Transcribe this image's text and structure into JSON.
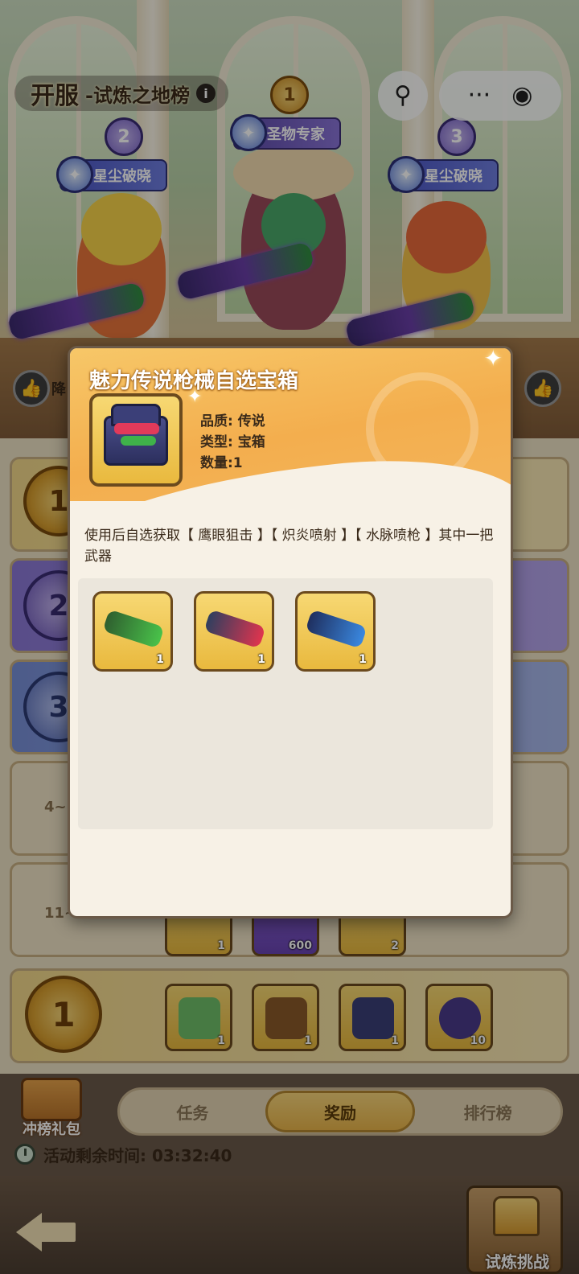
{
  "header": {
    "title_main": "开服",
    "title_sub": "-试炼之地榜",
    "info_glyph": "i"
  },
  "system_buttons": {
    "joystick_glyph": "⚲",
    "more_glyph": "···",
    "target_glyph": "◉"
  },
  "podium": [
    {
      "rank": "1",
      "title": "圣物专家"
    },
    {
      "rank": "2",
      "title": "星尘破晓"
    },
    {
      "rank": "3",
      "title": "星尘破晓"
    }
  ],
  "like_glyph": "👍",
  "partial_text": "降",
  "rows": [
    {
      "label": ""
    },
    {
      "label": ""
    },
    {
      "label": ""
    },
    {
      "label": "4~"
    },
    {
      "label": "11~20",
      "items": [
        {
          "qty": "1"
        },
        {
          "qty": "600"
        },
        {
          "qty": "2"
        }
      ]
    }
  ],
  "rank1_row": {
    "medal": "1",
    "items": [
      {
        "qty": "1"
      },
      {
        "qty": "1"
      },
      {
        "qty": "1"
      },
      {
        "qty": "10"
      }
    ]
  },
  "modal": {
    "title": "魅力传说枪械自选宝箱",
    "quality": "品质: 传说",
    "type": "类型: 宝箱",
    "count": "数量:1",
    "description": "使用后自选获取【 鹰眼狙击 】【 炽炎喷射 】【 水脉喷枪 】其中一把武器",
    "choices": [
      {
        "name": "鹰眼狙击",
        "qty": "1",
        "color": "#49c24a"
      },
      {
        "name": "炽炎喷射",
        "qty": "1",
        "color": "#e0344e"
      },
      {
        "name": "水脉喷枪",
        "qty": "1",
        "color": "#3a88e0"
      }
    ]
  },
  "tabs": [
    "任务",
    "奖励",
    "排行榜"
  ],
  "active_tab": "奖励",
  "gift_label": "冲榜礼包",
  "timer_text": "活动剩余时间: 03:32:40",
  "challenge_label": "试炼挑战",
  "colors": {
    "accent_gold": "#e9b93e",
    "modal_header": "#f3ae4e",
    "legend_slot": "#f7d873"
  }
}
